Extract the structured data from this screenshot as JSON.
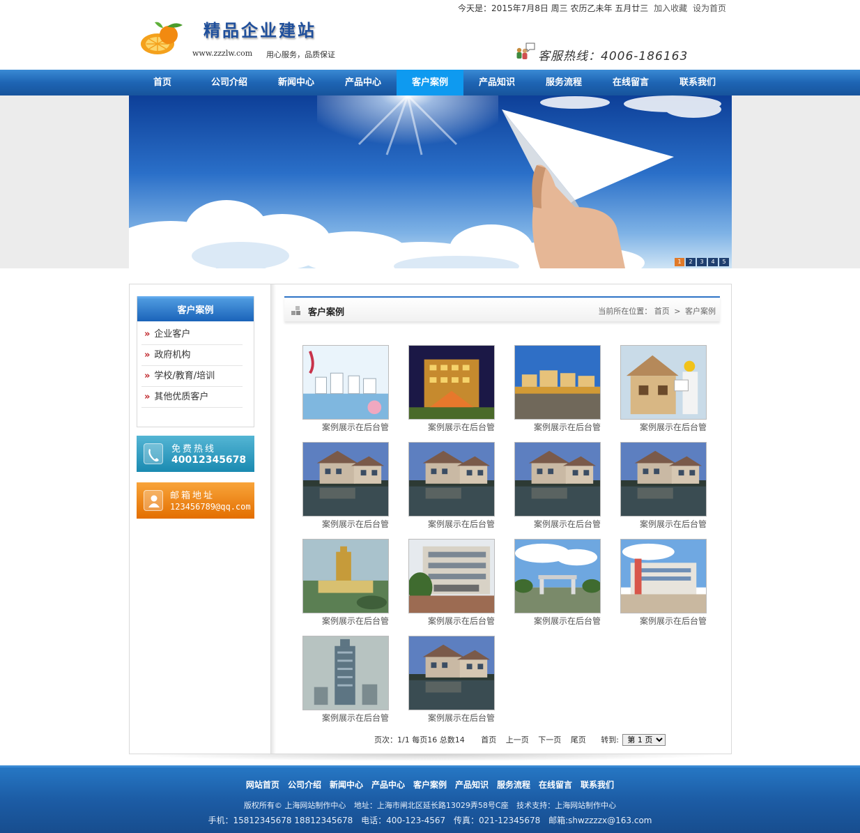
{
  "header": {
    "date_text": "今天是：2015年7月8日  周三  农历乙未年  五月廿三",
    "bookmark_link": "加入收藏",
    "homepage_link": "设为首页",
    "logo_title": "精品企业建站",
    "logo_url": "www.zzzlw.com",
    "slogan": "用心服务，品质保证",
    "hotline": "客服热线：4006-186163"
  },
  "nav": [
    {
      "label": "首页"
    },
    {
      "label": "公司介绍"
    },
    {
      "label": "新闻中心"
    },
    {
      "label": "产品中心"
    },
    {
      "label": "客户案例",
      "active": true
    },
    {
      "label": "产品知识"
    },
    {
      "label": "服务流程"
    },
    {
      "label": "在线留言"
    },
    {
      "label": "联系我们"
    }
  ],
  "banner": {
    "slides": [
      "1",
      "2",
      "3",
      "4",
      "5"
    ],
    "active_slide": "1"
  },
  "sidebar": {
    "title": "客户案例",
    "items": [
      {
        "label": "企业客户"
      },
      {
        "label": "政府机构"
      },
      {
        "label": "学校/教育/培训"
      },
      {
        "label": "其他优质客户"
      }
    ],
    "hotline_title": "免费热线",
    "hotline_number": "40012345678",
    "email_title": "邮箱地址",
    "email_value": "123456789@qq.com"
  },
  "content": {
    "title": "客户案例",
    "breadcrumb_prefix": "当前所在位置：",
    "breadcrumb_home": "首页",
    "breadcrumb_sep": ">",
    "breadcrumb_current": "客户案例",
    "cases": [
      {
        "caption": "案例展示在后台管",
        "scene": "poster"
      },
      {
        "caption": "案例展示在后台管",
        "scene": "night-building"
      },
      {
        "caption": "案例展示在后台管",
        "scene": "lake-town"
      },
      {
        "caption": "案例展示在后台管",
        "scene": "construction"
      },
      {
        "caption": "案例展示在后台管",
        "scene": "villa"
      },
      {
        "caption": "案例展示在后台管",
        "scene": "villa"
      },
      {
        "caption": "案例展示在后台管",
        "scene": "villa"
      },
      {
        "caption": "案例展示在后台管",
        "scene": "villa"
      },
      {
        "caption": "案例展示在后台管",
        "scene": "aerial-tower"
      },
      {
        "caption": "案例展示在后台管",
        "scene": "office-building"
      },
      {
        "caption": "案例展示在后台管",
        "scene": "factory-gate"
      },
      {
        "caption": "案例展示在后台管",
        "scene": "modern-office"
      },
      {
        "caption": "案例展示在后台管",
        "scene": "skyscraper"
      },
      {
        "caption": "案例展示在后台管",
        "scene": "villa"
      }
    ]
  },
  "pager": {
    "info": "页次：1/1  每页16  总数14",
    "first": "首页",
    "prev": "上一页",
    "next": "下一页",
    "last": "尾页",
    "goto_label": "转到:",
    "selected_page": "第 1 页"
  },
  "footer": {
    "links": [
      "网站首页",
      "公司介绍",
      "新闻中心",
      "产品中心",
      "客户案例",
      "产品知识",
      "服务流程",
      "在线留言",
      "联系我们"
    ],
    "copyright": "版权所有© 上海网站制作中心",
    "address": "地址：上海市闸北区延长路13029弄58号C座",
    "support": "技术支持：上海网站制作中心",
    "mobile": "手机：15812345678 18812345678",
    "phone": "电话：400-123-4567",
    "fax": "传真：021-12345678",
    "email": "邮箱:shwzzzzx@163.com"
  },
  "colors": {
    "nav_blue": "#1e65b4",
    "nav_active": "#0e9af0",
    "accent_red": "#c0282d",
    "card_blue": "#1a8ab1",
    "card_orange": "#e36e00"
  }
}
